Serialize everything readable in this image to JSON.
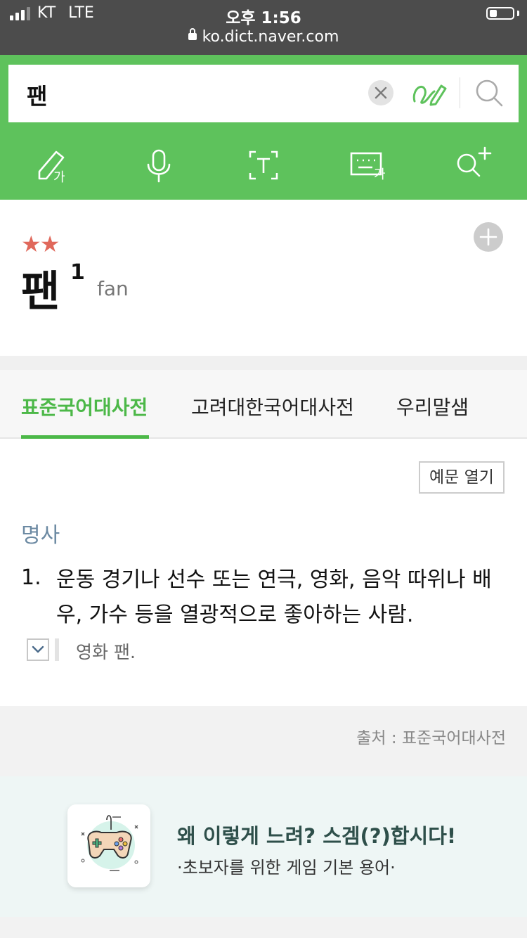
{
  "status_bar": {
    "carrier": "KT",
    "network": "LTE",
    "time": "오후 1:56",
    "url": "ko.dict.naver.com",
    "signal_bars": 3,
    "battery_level": 0.25
  },
  "search": {
    "query": "팬",
    "icons": [
      "close-icon",
      "handwriting-icon",
      "search-icon"
    ]
  },
  "toolbar": {
    "icons": [
      "handwriting-input-icon",
      "microphone-icon",
      "text-recognition-icon",
      "korean-keyboard-icon",
      "search-plus-icon"
    ],
    "handwriting_glyph": "가",
    "keyboard_glyph": "가"
  },
  "entry": {
    "stars": "★★",
    "star_count": 2,
    "word": "팬",
    "homonym_number": "1",
    "origin": "fan"
  },
  "tabs": [
    {
      "label": "표준국어대사전",
      "active": true
    },
    {
      "label": "고려대한국어대사전",
      "active": false
    },
    {
      "label": "우리말샘",
      "active": false
    }
  ],
  "definition": {
    "example_toggle_label": "예문 열기",
    "part_of_speech": "명사",
    "number": "1.",
    "text": "운동 경기나 선수 또는 연극, 영화, 음악 따위나 배우, 가수 등을 열광적으로 좋아하는 사람.",
    "example": "영화 팬."
  },
  "source": "출처 : 표준국어대사전",
  "ad": {
    "title": "왜 이렇게 느려? 스겜(?)합시다!",
    "subtitle": "·초보자를 위한 게임 기본 용어·",
    "icon": "gamepad-icon"
  },
  "colors": {
    "brand_green": "#5ec25c",
    "active_tab": "#4cb848",
    "star": "#e0685b",
    "status_bar": "#4c4c4c"
  }
}
